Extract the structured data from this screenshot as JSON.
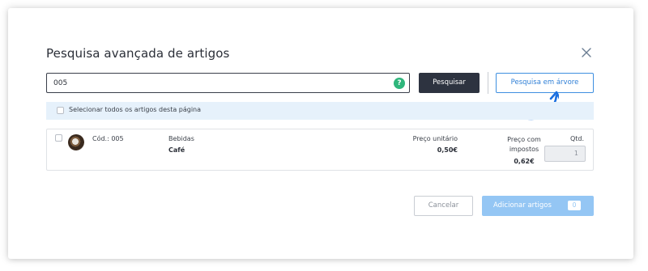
{
  "dialog": {
    "title": "Pesquisa avançada de artigos",
    "close_icon": "close-icon"
  },
  "search": {
    "value": "005",
    "help_icon": "?",
    "search_button": "Pesquisar",
    "tree_button": "Pesquisa em árvore"
  },
  "select_all": {
    "label": "Selecionar todos os artigos desta página",
    "checked": false
  },
  "article": {
    "code": "Cód.: 005",
    "category": "Bebidas",
    "name": "Café",
    "unit_price_label": "Preço unitário",
    "unit_price": "0,50€",
    "tax_price_label": "Preço com impostos",
    "tax_price": "0,62€",
    "qty_label": "Qtd.",
    "qty": "1",
    "checked": false
  },
  "footer": {
    "cancel": "Cancelar",
    "add": "Adicionar artigos",
    "add_count": "0"
  },
  "colors": {
    "dark_button": "#2d3340",
    "accent_blue": "#2f7fd6",
    "add_button": "#94c6f4",
    "help_green": "#2fb67c",
    "select_bar": "#e6f1fb"
  }
}
